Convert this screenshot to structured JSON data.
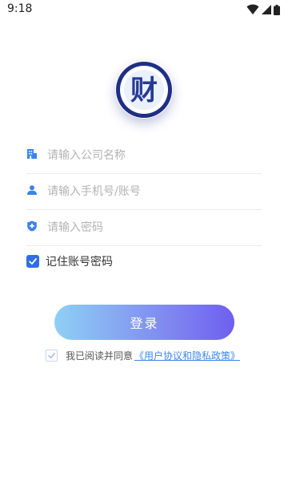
{
  "status_bar": {
    "time": "9:18"
  },
  "logo": {
    "glyph": "财",
    "ring_color": "#2b3a90",
    "glyph_color": "#273a93"
  },
  "form": {
    "company": {
      "placeholder": "请输入公司名称",
      "value": ""
    },
    "phone": {
      "placeholder": "请输入手机号/账号",
      "value": ""
    },
    "password": {
      "placeholder": "请输入密码",
      "value": ""
    },
    "remember": {
      "label": "记住账号密码",
      "checked": true
    },
    "icons": [
      "building-icon",
      "user-icon",
      "shield-icon"
    ]
  },
  "login_button": {
    "label": "登录"
  },
  "agreement": {
    "checked": false,
    "text": "我已阅读并同意",
    "link": "《用户协议和隐私政策》"
  },
  "colors": {
    "accent": "#2f6ee6",
    "link": "#3f86e8",
    "icon": "#3b82f0"
  }
}
